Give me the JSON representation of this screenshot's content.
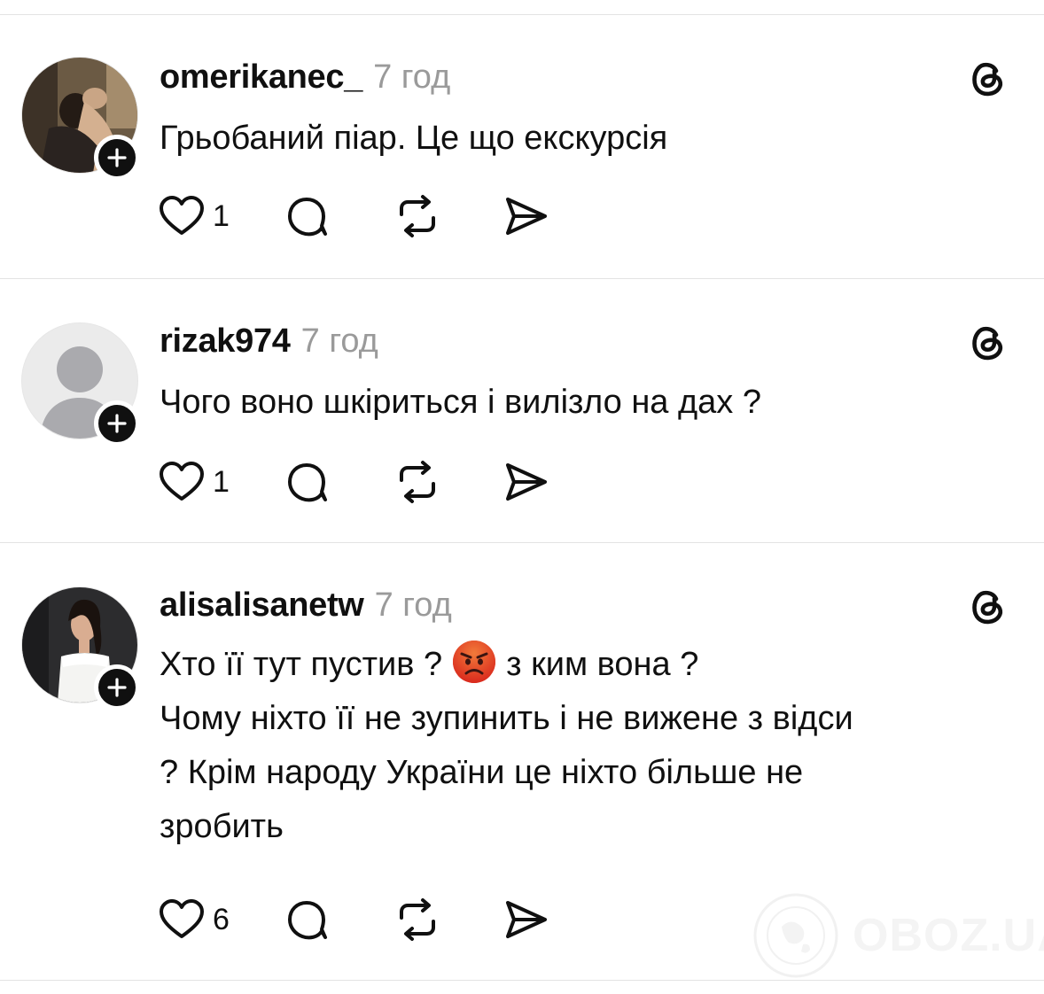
{
  "posts": [
    {
      "username": "omerikanec_",
      "time": "7 год",
      "lines": [
        "Грьобаний піар. Це що екскурсія"
      ],
      "likes": "1",
      "avatar": "photo"
    },
    {
      "username": "rizak974",
      "time": "7 год",
      "lines": [
        "Чого воно шкіриться і вилізло на дах ?"
      ],
      "likes": "1",
      "avatar": "default-person"
    },
    {
      "username": "alisalisanetw",
      "time": "7 год",
      "line1_before_emoji": "Хто її тут пустив ?",
      "emoji": "angry-face",
      "line1_after_emoji": "з ким вона ?",
      "lines_rest": [
        "Чому ніхто її не зупинить і не вижене з відси",
        "? Крім народу України це ніхто більше не",
        "зробить"
      ],
      "likes": "6",
      "avatar": "photo"
    }
  ],
  "icons": {
    "like": "heart-icon",
    "reply": "comment-bubble-icon",
    "repost": "repost-arrows-icon",
    "share": "send-paper-plane-icon",
    "app": "threads-logo-icon",
    "follow": "plus-icon"
  },
  "watermark": {
    "text": "OBOZ.UA"
  },
  "colors": {
    "text": "#101010",
    "muted": "#9a9a9a",
    "divider": "#e3e3e3",
    "badge": "#101010"
  }
}
